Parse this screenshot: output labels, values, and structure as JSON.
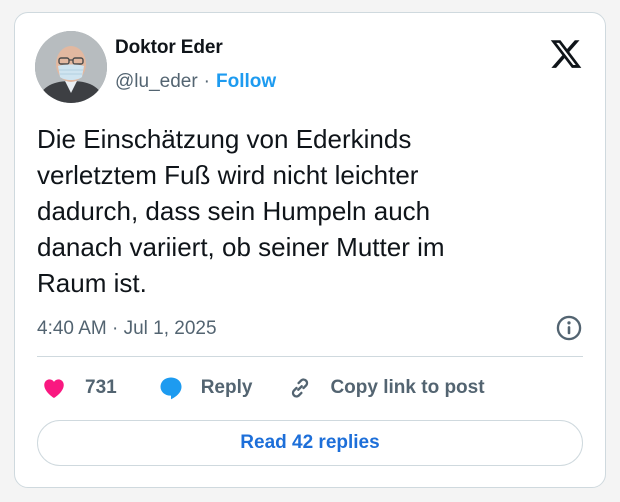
{
  "author": {
    "name": "Doktor Eder",
    "handle": "@lu_eder",
    "separator": "·",
    "follow_label": "Follow"
  },
  "tweet": {
    "text": "Die Einschätzung von Ederkinds\nverletztem Fuß wird nicht leichter\ndadurch, dass sein Humpeln auch\ndanach variiert, ob seiner Mutter im\nRaum ist.",
    "timestamp": "4:40 AM · Jul 1, 2025"
  },
  "actions": {
    "like_count": "731",
    "reply_label": "Reply",
    "copy_link_label": "Copy link to post"
  },
  "read_replies_label": "Read 42 replies",
  "icons": {
    "brand": "x-logo-icon",
    "info": "info-icon",
    "like": "heart-icon",
    "reply": "speech-bubble-icon",
    "copy": "link-icon"
  },
  "colors": {
    "accent": "#1d9bf0",
    "like": "#f91880",
    "muted": "#536471",
    "text": "#0f1419",
    "border": "#cfd9de"
  }
}
